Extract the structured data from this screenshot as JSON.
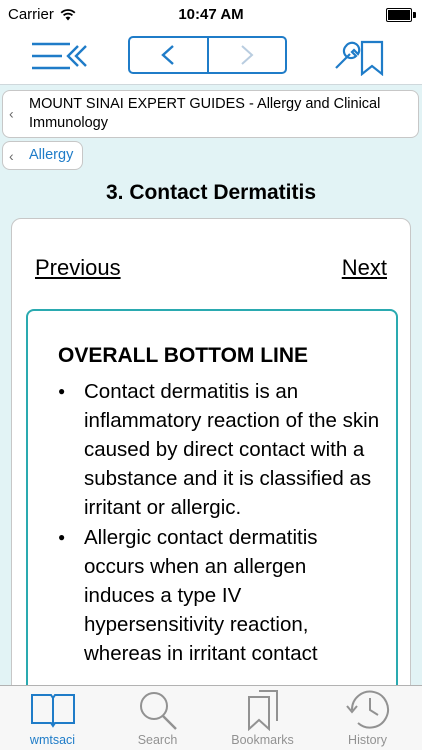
{
  "status": {
    "carrier": "Carrier",
    "time": "10:47 AM"
  },
  "breadcrumbs": [
    "MOUNT SINAI EXPERT GUIDES - Allergy and Clinical Immunology",
    "Allergy"
  ],
  "page_title": "3. Contact Dermatitis",
  "pager": {
    "previous": "Previous",
    "next": "Next"
  },
  "section": {
    "title": "OVERALL BOTTOM LINE",
    "bullets": [
      "Contact dermatitis is an inflammatory reaction of the skin caused by direct contact with a substance and it is classified as irritant or allergic.",
      "Allergic contact dermatitis occurs when an allergen induces a type IV hypersensitivity reaction, whereas in irritant contact"
    ]
  },
  "tabs": [
    {
      "label": "wmtsaci",
      "icon": "book-icon",
      "active": true
    },
    {
      "label": "Search",
      "icon": "search-icon",
      "active": false
    },
    {
      "label": "Bookmarks",
      "icon": "bookmarks-icon",
      "active": false
    },
    {
      "label": "History",
      "icon": "history-icon",
      "active": false
    }
  ],
  "colors": {
    "accent": "#1f7cc8",
    "content_bg": "#e2f3f5",
    "section_border": "#2aaab0"
  }
}
